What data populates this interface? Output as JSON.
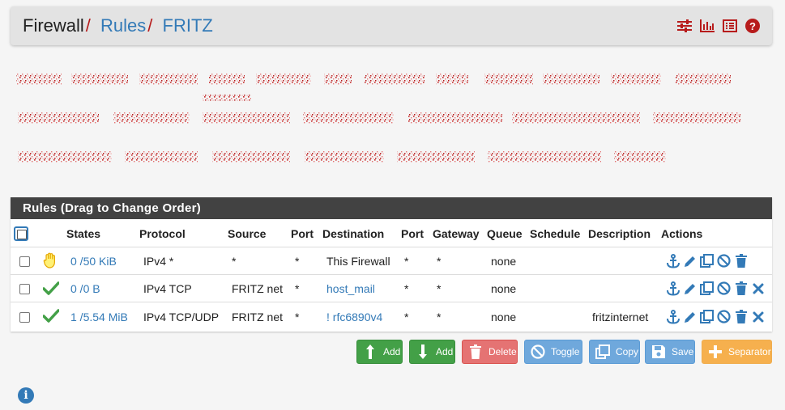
{
  "breadcrumb": {
    "root": "Firewall",
    "rules": "Rules",
    "interface": "FRITZ",
    "separator": "/"
  },
  "header_icons": [
    "sliders-icon",
    "bar-chart-icon",
    "list-icon",
    "help-icon"
  ],
  "panel": {
    "title": "Rules (Drag to Change Order)",
    "columns": [
      "States",
      "Protocol",
      "Source",
      "Port",
      "Destination",
      "Port",
      "Gateway",
      "Queue",
      "Schedule",
      "Description",
      "Actions"
    ]
  },
  "rules": [
    {
      "status_icon": "hand-block-icon",
      "states": "0 /50 KiB",
      "protocol": "IPv4 *",
      "source": "*",
      "source_port": "*",
      "destination": "This Firewall",
      "dest_port": "*",
      "gateway": "*",
      "queue": "none",
      "schedule": "",
      "description": ""
    },
    {
      "status_icon": "check-icon",
      "states": "0 /0 B",
      "protocol": "IPv4 TCP",
      "source": "FRITZ net",
      "source_port": "*",
      "destination": "host_mail",
      "dest_port": "*",
      "gateway": "*",
      "queue": "none",
      "schedule": "",
      "description": ""
    },
    {
      "status_icon": "check-icon",
      "states": "1 /5.54 MiB",
      "protocol": "IPv4 TCP/UDP",
      "source": "FRITZ net",
      "source_port": "*",
      "destination": "! rfc6890v4",
      "dest_port": "*",
      "gateway": "*",
      "queue": "none",
      "schedule": "",
      "description": "fritzinternet"
    }
  ],
  "buttons": {
    "add_top": "Add",
    "add_bottom": "Add",
    "delete": "Delete",
    "toggle": "Toggle",
    "copy": "Copy",
    "save": "Save",
    "separator": "Separator"
  },
  "colors": {
    "accent": "#337ab7",
    "header_bg": "#424242",
    "crumb_sep": "#b71c1c",
    "success": "#43a047",
    "danger": "#e57373",
    "info": "#6fa8dc",
    "warning": "#f6b04e"
  }
}
